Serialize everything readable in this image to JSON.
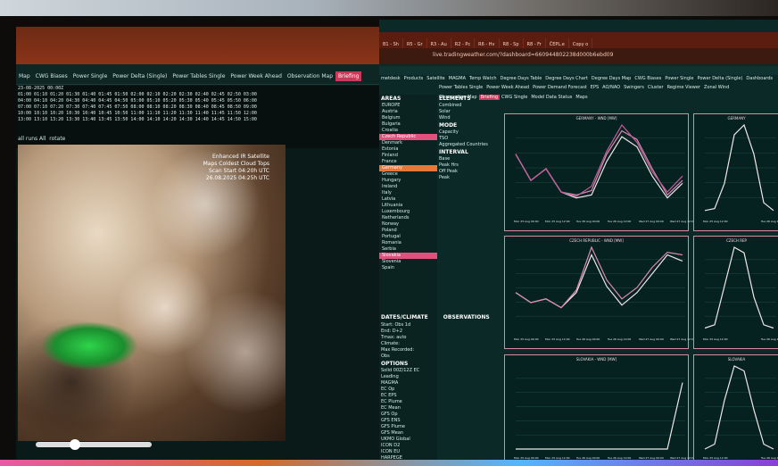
{
  "left": {
    "nav_items": [
      "Map",
      "CWG Biases",
      "Power Single",
      "Power Delta (Single)",
      "Power Tables Single",
      "Power Week Ahead",
      "Observation Map",
      "Briefing",
      "CWG Single",
      "Model Data Status",
      "Maps"
    ],
    "nav_highlight": "Briefing",
    "dashboards_label": "Dashboards",
    "satellite_label": "Satellite",
    "date_label": "23-08-2025 00:00Z",
    "time_rows": [
      "01:00 01:10 01:20 01:30 01:40 01:45 01:50 02:00 02:10 02:20 02:30 02:40 02:45 02:50 03:00",
      "04:00 04:10 04:20 04:30 04:40 04:45 04:50 05:00 05:10 05:20 05:30 05:40 05:45 05:50 06:00",
      "07:00 07:10 07:20 07:30 07:40 07:45 07:50 08:00 08:10 08:20 08:30 08:40 08:45 08:50 09:00",
      "10:00 10:10 10:20 10:30 10:40 10:45 10:50 11:00 11:10 11:20 11:30 11:40 11:45 11:50 12:00",
      "13:00 13:10 13:20 13:30 13:40 13:45 13:50 14:00 14:10 14:20 14:30 14:40 14:45 14:50 15:00"
    ],
    "runs_label": "all runs  All",
    "rotate_label": "rotate",
    "sat_title": "Enhanced IR Satellite",
    "sat_sub": "Maps Coldest Cloud Tops",
    "sat_scan": "Scan Start 04:20h UTC",
    "sat_date": "26.08.2025 04:25h UTC"
  },
  "right": {
    "tabs": [
      "B1 - Sh",
      "R5 - Gr",
      "R3 - Au",
      "R2 - Pc",
      "R6 - Hv",
      "R8 - Sp",
      "R8 - Fr",
      "ČEPL.e",
      "Copy o"
    ],
    "url": "live.tradingweather.com/?dashboard=660944802238d000b6ebd09",
    "menu_items": [
      "metdesk",
      "Products",
      "Satellite",
      "MAGMA",
      "Temp Watch",
      "Degree Days Table",
      "Degree Days Chart",
      "Degree Days Map",
      "CWG Biases",
      "Power Single",
      "Power Delta (Single)",
      "Dashboards"
    ],
    "menu2_items": [
      "Power Tables Single",
      "Power Week Ahead",
      "Power Demand Forecast",
      "EPS",
      "AO/NAO",
      "Swingers",
      "Cluster",
      "Regime Viewer",
      "Zonal Wind"
    ],
    "menu3_items": [
      "Observation Map",
      "Briefing",
      "CWG Single",
      "Model Data Status",
      "Maps"
    ],
    "menu3_highlight": "Briefing",
    "areas_title": "AREAS",
    "areas": [
      "EUROPE",
      "Austria",
      "Belgium",
      "Bulgaria",
      "Croatia",
      "Czech Republic",
      "Denmark",
      "Estonia",
      "Finland",
      "France",
      "Germany",
      "Greece",
      "Hungary",
      "Ireland",
      "Italy",
      "Latvia",
      "Lithuania",
      "Luxembourg",
      "Netherlands",
      "Norway",
      "Poland",
      "Portugal",
      "Romania",
      "Serbia",
      "Slovakia",
      "Slovenia",
      "Spain"
    ],
    "areas_highlight": [
      "Czech Republic",
      "Slovakia"
    ],
    "areas_orange": [
      "Germany"
    ],
    "elements_title": "ELEMENTS",
    "elements": [
      "Combined",
      "Solar",
      "Wind"
    ],
    "mode_title": "MODE",
    "mode": [
      "Capacity",
      "TSO",
      "Aggregated Countries"
    ],
    "interval_title": "INTERVAL",
    "interval": [
      "Base",
      "Peak Hrs",
      "Off Peak",
      "Peak"
    ],
    "dates_title": "DATES/CLIMATE",
    "obs_title": "OBSERVATIONS",
    "options_title": "OPTIONS",
    "dates_rows": [
      "Start:  Obs 1d",
      "End:  D+2",
      "Tmax:  auto",
      "Climate:",
      "Max Recorded:"
    ],
    "obs_label": "Obs",
    "options_label": "Solid 00Z/12Z EC",
    "models": [
      "Leading",
      "MAGMA",
      "EC Op",
      "EC EPS",
      "EC Plume",
      "EC Mean",
      "GFS Op",
      "GFS ENS",
      "GFS Plume",
      "GFS Mean",
      "UKMO Global",
      "ICON D2",
      "ICON EU",
      "HARPEGE"
    ]
  },
  "chart_data": [
    {
      "type": "line",
      "title": "GERMANY - WND [MW]",
      "x": [
        "Mon 25 Aug 00:00",
        "Mon 25 Aug 12:00",
        "Tue 26 Aug 00:00",
        "Tue 26 Aug 12:00",
        "Wed 27 Aug 00:00",
        "Wed 27 Aug 12:00"
      ],
      "series": [
        {
          "values": [
            40,
            22,
            30,
            14,
            10,
            12,
            35,
            52,
            45,
            25,
            10,
            20
          ]
        },
        {
          "values": [
            40,
            22,
            30,
            14,
            12,
            15,
            40,
            56,
            50,
            30,
            12,
            22
          ]
        },
        {
          "values": [
            40,
            22,
            30,
            14,
            11,
            18,
            42,
            60,
            48,
            28,
            14,
            25
          ]
        }
      ]
    },
    {
      "type": "line",
      "title": "GERMANY",
      "x": [
        "Mon 25 Aug 12:00",
        "Tue 26 Aug 12:00"
      ],
      "series": [
        {
          "values": [
            2,
            4,
            30,
            80,
            90,
            60,
            10,
            2
          ]
        }
      ]
    },
    {
      "type": "line",
      "title": "CZECH REPUBLIC - WND [MW]",
      "x": [
        "Mon 25 Aug 00:00",
        "Mon 25 Aug 12:00",
        "Tue 26 Aug 00:00",
        "Tue 26 Aug 12:00",
        "Wed 27 Aug 00:00",
        "Wed 27 Aug 12:00"
      ],
      "series": [
        {
          "values": [
            30,
            22,
            25,
            18,
            30,
            60,
            35,
            20,
            30,
            45,
            60,
            55
          ]
        },
        {
          "values": [
            30,
            22,
            25,
            18,
            32,
            66,
            40,
            25,
            34,
            50,
            62,
            60
          ]
        }
      ]
    },
    {
      "type": "line",
      "title": "CZECH REP",
      "x": [
        "Mon 25 Aug 12:00",
        "Tue 26 Aug 12:00"
      ],
      "series": [
        {
          "values": [
            2,
            5,
            40,
            75,
            70,
            30,
            5,
            2
          ]
        }
      ]
    },
    {
      "type": "line",
      "title": "SLOVAKIA - WND [MW]",
      "ylim": [
        0,
        1.25
      ],
      "x": [
        "Mon 25 Aug 00:00",
        "Mon 25 Aug 12:00",
        "Tue 26 Aug 00:00",
        "Tue 26 Aug 12:00",
        "Wed 27 Aug 00:00",
        "Wed 27 Aug 12:00"
      ],
      "series": [
        {
          "values": [
            0,
            0,
            0,
            0,
            0,
            0,
            0,
            0,
            0,
            0,
            0,
            1.0
          ]
        }
      ]
    },
    {
      "type": "line",
      "title": "SLOVAKIA",
      "x": [
        "Mon 25 Aug 12:00",
        "Tue 26 Aug 12:00"
      ],
      "series": [
        {
          "values": [
            0,
            5,
            50,
            85,
            80,
            40,
            5,
            0
          ]
        }
      ]
    }
  ]
}
